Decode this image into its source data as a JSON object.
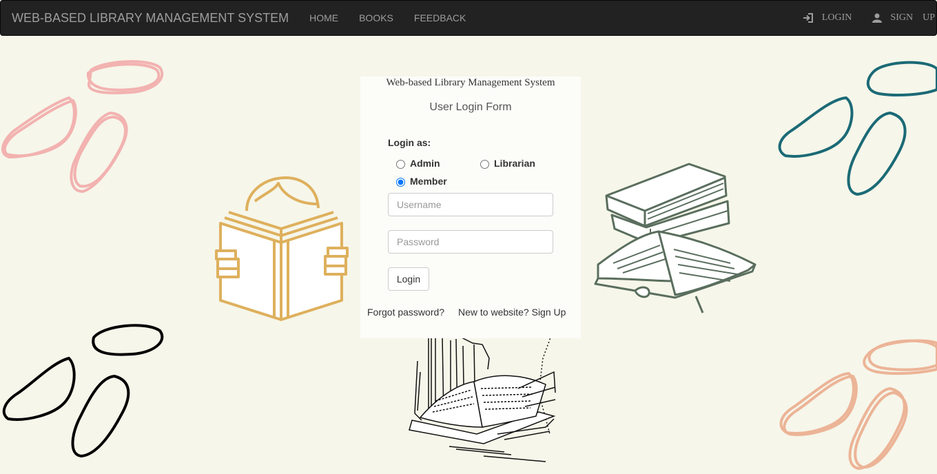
{
  "navbar": {
    "brand": "WEB-BASED LIBRARY MANAGEMENT SYSTEM",
    "links": [
      "HOME",
      "BOOKS",
      "FEEDBACK"
    ],
    "login": "LOGIN",
    "signup_1": "SIGN",
    "signup_2": "UP",
    "login_icon": "log-in-icon",
    "signup_icon": "user-icon"
  },
  "panel": {
    "title": "Web-based Library Management System",
    "form_title": "User Login Form",
    "login_as": "Login as:",
    "roles": [
      "Admin",
      "Librarian",
      "Member"
    ],
    "selected_role": "Member",
    "username_placeholder": "Username",
    "password_placeholder": "Password",
    "login_button": "Login",
    "forgot_password": "Forgot password?",
    "signup_prompt": "New to website? Sign Up"
  },
  "colors": {
    "background": "#f6f6ea",
    "navbar": "#222222",
    "reader_gold": "#deb05d",
    "books_green": "#5a6e5e",
    "squiggle_pink": "#f2b2b0",
    "squiggle_teal": "#1b6a76",
    "squiggle_peach": "#ecb497"
  }
}
